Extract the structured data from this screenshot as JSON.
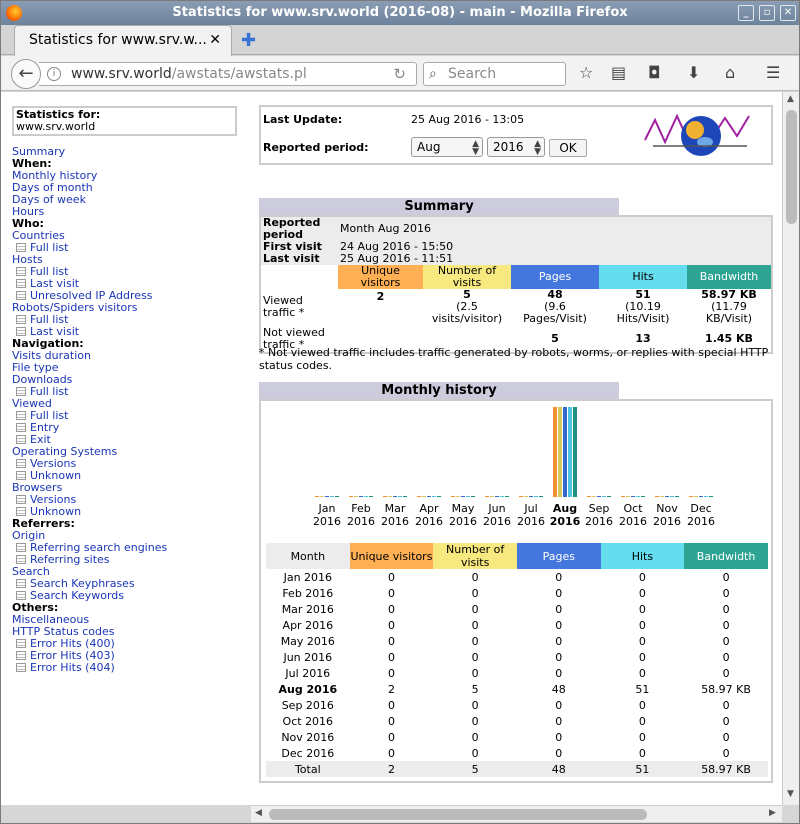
{
  "window": {
    "title": "Statistics for www.srv.world (2016-08) - main - Mozilla Firefox"
  },
  "tab": {
    "label": "Statistics for www.srv.w...",
    "close": "✕"
  },
  "urlbar": {
    "domain": "www.srv.world",
    "path": "/awstats/awstats.pl"
  },
  "search": {
    "placeholder": "Search"
  },
  "left": {
    "stats_for_label": "Statistics for:",
    "stats_for_value": "www.srv.world",
    "items": [
      {
        "t": "Summary",
        "k": "link"
      },
      {
        "t": "When:",
        "k": "h"
      },
      {
        "t": "Monthly history",
        "k": "link"
      },
      {
        "t": "Days of month",
        "k": "link"
      },
      {
        "t": "Days of week",
        "k": "link"
      },
      {
        "t": "Hours",
        "k": "link"
      },
      {
        "t": "Who:",
        "k": "h"
      },
      {
        "t": "Countries",
        "k": "link"
      },
      {
        "t": "Full list",
        "k": "sub"
      },
      {
        "t": "Hosts",
        "k": "link"
      },
      {
        "t": "Full list",
        "k": "sub"
      },
      {
        "t": "Last visit",
        "k": "sub"
      },
      {
        "t": "Unresolved IP Address",
        "k": "sub"
      },
      {
        "t": "Robots/Spiders visitors",
        "k": "link"
      },
      {
        "t": "Full list",
        "k": "sub"
      },
      {
        "t": "Last visit",
        "k": "sub"
      },
      {
        "t": "Navigation:",
        "k": "h"
      },
      {
        "t": "Visits duration",
        "k": "link"
      },
      {
        "t": "File type",
        "k": "link"
      },
      {
        "t": "Downloads",
        "k": "link"
      },
      {
        "t": "Full list",
        "k": "sub"
      },
      {
        "t": "Viewed",
        "k": "link"
      },
      {
        "t": "Full list",
        "k": "sub"
      },
      {
        "t": "Entry",
        "k": "sub"
      },
      {
        "t": "Exit",
        "k": "sub"
      },
      {
        "t": "Operating Systems",
        "k": "link"
      },
      {
        "t": "Versions",
        "k": "sub"
      },
      {
        "t": "Unknown",
        "k": "sub"
      },
      {
        "t": "Browsers",
        "k": "link"
      },
      {
        "t": "Versions",
        "k": "sub"
      },
      {
        "t": "Unknown",
        "k": "sub"
      },
      {
        "t": "Referrers:",
        "k": "h"
      },
      {
        "t": "Origin",
        "k": "link"
      },
      {
        "t": "Referring search engines",
        "k": "sub"
      },
      {
        "t": "Referring sites",
        "k": "sub"
      },
      {
        "t": "Search",
        "k": "link"
      },
      {
        "t": "Search Keyphrases",
        "k": "sub"
      },
      {
        "t": "Search Keywords",
        "k": "sub"
      },
      {
        "t": "Others:",
        "k": "h"
      },
      {
        "t": "Miscellaneous",
        "k": "link"
      },
      {
        "t": "HTTP Status codes",
        "k": "link"
      },
      {
        "t": "Error Hits (400)",
        "k": "sub"
      },
      {
        "t": "Error Hits (403)",
        "k": "sub"
      },
      {
        "t": "Error Hits (404)",
        "k": "sub"
      }
    ]
  },
  "update": {
    "last_update_label": "Last Update:",
    "last_update_value": "25 Aug 2016 - 13:05",
    "period_label": "Reported period:",
    "month": "Aug",
    "year": "2016",
    "ok": "OK"
  },
  "summary": {
    "title": "Summary",
    "reported_period_label": "Reported period",
    "reported_period_value": "Month Aug 2016",
    "first_visit_label": "First visit",
    "first_visit_value": "24 Aug 2016 - 15:50",
    "last_visit_label": "Last visit",
    "last_visit_value": "25 Aug 2016 - 11:51",
    "headers": [
      "Unique visitors",
      "Number of visits",
      "Pages",
      "Hits",
      "Bandwidth"
    ],
    "viewed_label": "Viewed traffic *",
    "viewed": {
      "unique": "2",
      "visits": "5",
      "visits_sub": "(2.5 visits/visitor)",
      "pages": "48",
      "pages_sub": "(9.6 Pages/Visit)",
      "hits": "51",
      "hits_sub": "(10.19 Hits/Visit)",
      "bw": "58.97 KB",
      "bw_sub": "(11.79 KB/Visit)"
    },
    "notviewed_label": "Not viewed traffic *",
    "notviewed": {
      "pages": "5",
      "hits": "13",
      "bw": "1.45 KB"
    },
    "note": "* Not viewed traffic includes traffic generated by robots, worms, or replies with special HTTP status codes."
  },
  "monthly": {
    "title": "Monthly history",
    "headers": [
      "Month",
      "Unique visitors",
      "Number of visits",
      "Pages",
      "Hits",
      "Bandwidth"
    ],
    "rows": [
      [
        "Jan 2016",
        "0",
        "0",
        "0",
        "0",
        "0"
      ],
      [
        "Feb 2016",
        "0",
        "0",
        "0",
        "0",
        "0"
      ],
      [
        "Mar 2016",
        "0",
        "0",
        "0",
        "0",
        "0"
      ],
      [
        "Apr 2016",
        "0",
        "0",
        "0",
        "0",
        "0"
      ],
      [
        "May 2016",
        "0",
        "0",
        "0",
        "0",
        "0"
      ],
      [
        "Jun 2016",
        "0",
        "0",
        "0",
        "0",
        "0"
      ],
      [
        "Jul 2016",
        "0",
        "0",
        "0",
        "0",
        "0"
      ],
      [
        "Aug 2016",
        "2",
        "5",
        "48",
        "51",
        "58.97 KB"
      ],
      [
        "Sep 2016",
        "0",
        "0",
        "0",
        "0",
        "0"
      ],
      [
        "Oct 2016",
        "0",
        "0",
        "0",
        "0",
        "0"
      ],
      [
        "Nov 2016",
        "0",
        "0",
        "0",
        "0",
        "0"
      ],
      [
        "Dec 2016",
        "0",
        "0",
        "0",
        "0",
        "0"
      ]
    ],
    "total": [
      "Total",
      "2",
      "5",
      "48",
      "51",
      "58.97 KB"
    ]
  },
  "chart_data": {
    "type": "bar",
    "categories": [
      "Jan 2016",
      "Feb 2016",
      "Mar 2016",
      "Apr 2016",
      "May 2016",
      "Jun 2016",
      "Jul 2016",
      "Aug 2016",
      "Sep 2016",
      "Oct 2016",
      "Nov 2016",
      "Dec 2016"
    ],
    "x_month": [
      "Jan",
      "Feb",
      "Mar",
      "Apr",
      "May",
      "Jun",
      "Jul",
      "Aug",
      "Sep",
      "Oct",
      "Nov",
      "Dec"
    ],
    "x_year": "2016",
    "series": [
      {
        "name": "Unique visitors",
        "color": "#f09030",
        "values": [
          0,
          0,
          0,
          0,
          0,
          0,
          0,
          2,
          0,
          0,
          0,
          0
        ]
      },
      {
        "name": "Number of visits",
        "color": "#d8c860",
        "values": [
          0,
          0,
          0,
          0,
          0,
          0,
          0,
          5,
          0,
          0,
          0,
          0
        ]
      },
      {
        "name": "Pages",
        "color": "#3368cc",
        "values": [
          0,
          0,
          0,
          0,
          0,
          0,
          0,
          48,
          0,
          0,
          0,
          0
        ]
      },
      {
        "name": "Hits",
        "color": "#4cc4e0",
        "values": [
          0,
          0,
          0,
          0,
          0,
          0,
          0,
          51,
          0,
          0,
          0,
          0
        ]
      },
      {
        "name": "Bandwidth",
        "color": "#1f8f80",
        "values": [
          0,
          0,
          0,
          0,
          0,
          0,
          0,
          58.97,
          0,
          0,
          0,
          0
        ]
      }
    ],
    "highlight": "Aug"
  }
}
